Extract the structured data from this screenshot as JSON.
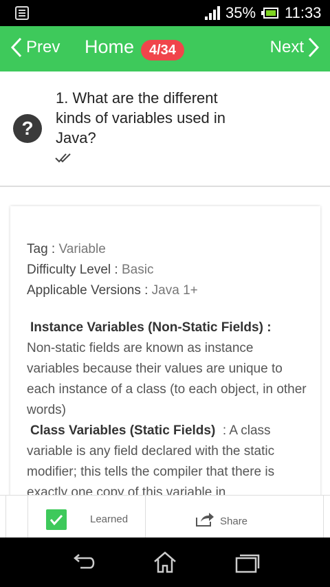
{
  "status_bar": {
    "battery_percent": "35%",
    "time": "11:33",
    "icons": [
      "notification-icon",
      "signal-icon",
      "battery-icon"
    ]
  },
  "nav": {
    "prev_label": "Prev",
    "title": "Home",
    "counter": "4/34",
    "next_label": "Next",
    "accent_color": "#3ec95b",
    "badge_color": "#f0454b"
  },
  "question": {
    "text": "1. What are the different kinds of variables used in Java?",
    "icon": "question-icon",
    "read_icon": "double-check-icon"
  },
  "meta": {
    "tag_label": "Tag : ",
    "tag_value": "Variable",
    "difficulty_label": "Difficulty Level : ",
    "difficulty_value": "Basic",
    "versions_label": "Applicable Versions : ",
    "versions_value": "Java 1+"
  },
  "answer": {
    "heading1": "Instance Variables (Non-Static Fields) :",
    "para1": "Non-static fields are known as instance variables because their values are unique to each instance of a class (to each object, in other words)",
    "heading2": "Class Variables (Static Fields)",
    "para2": ": A class variable is any field declared with the static modifier; this tells the compiler that there is exactly one copy of this variable in"
  },
  "bottom_bar": {
    "learned_label": "Learned",
    "learned_checked": true,
    "share_label": "Share"
  },
  "system_nav": {
    "icons": [
      "back-icon",
      "home-icon",
      "recents-icon"
    ]
  }
}
